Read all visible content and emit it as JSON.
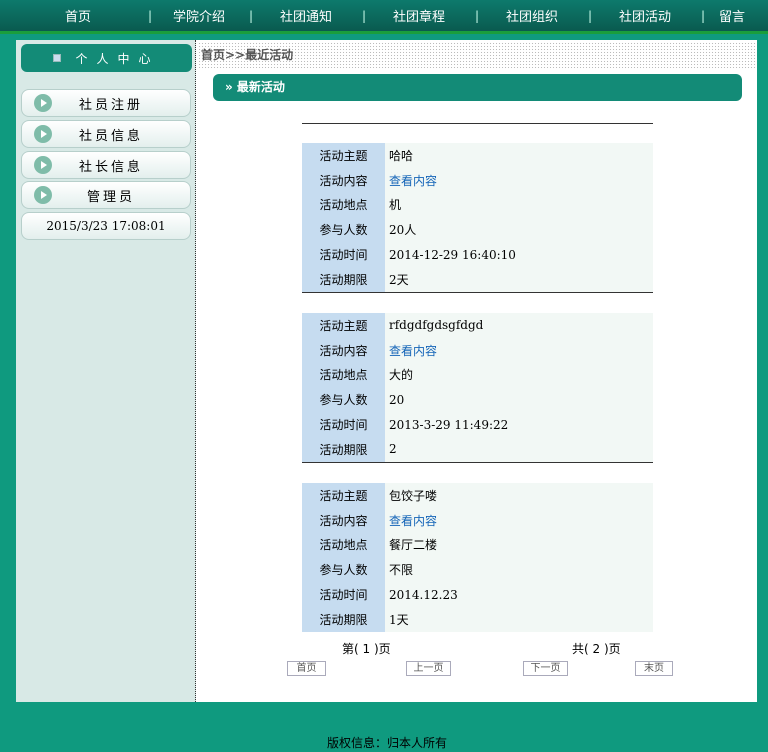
{
  "nav": [
    "首页",
    "学院介绍",
    "社团通知",
    "社团章程",
    "社团组织",
    "社团活动",
    "留言"
  ],
  "sidebar": {
    "title": "个人中心",
    "items": [
      "社员注册",
      "社员信息",
      "社长信息",
      "管理员"
    ],
    "datetime": "2015/3/23 17:08:01"
  },
  "breadcrumb": "首页>>最近活动",
  "section_title": "» 最新活动",
  "labels": [
    "活动主题",
    "活动内容",
    "活动地点",
    "参与人数",
    "活动时间",
    "活动期限"
  ],
  "activities": [
    {
      "topic": "哈哈",
      "content": "查看内容",
      "place": "机",
      "people": "20人",
      "time": "2014-12-29 16:40:10",
      "duration": "2天"
    },
    {
      "topic": "rfdgdfgdsgfdgd",
      "content": "查看内容",
      "place": "大的",
      "people": "20",
      "time": "2013-3-29 11:49:22",
      "duration": "2"
    },
    {
      "topic": "包饺子喽",
      "content": "查看内容",
      "place": "餐厅二楼",
      "people": "不限",
      "time": "2014.12.23",
      "duration": "1天"
    }
  ],
  "pager": {
    "current": "第( 1 )页",
    "total": "共( 2 )页",
    "first": "首页",
    "prev": "上一页",
    "next": "下一页",
    "last": "末页"
  },
  "footer": "版权信息：归本人所有"
}
